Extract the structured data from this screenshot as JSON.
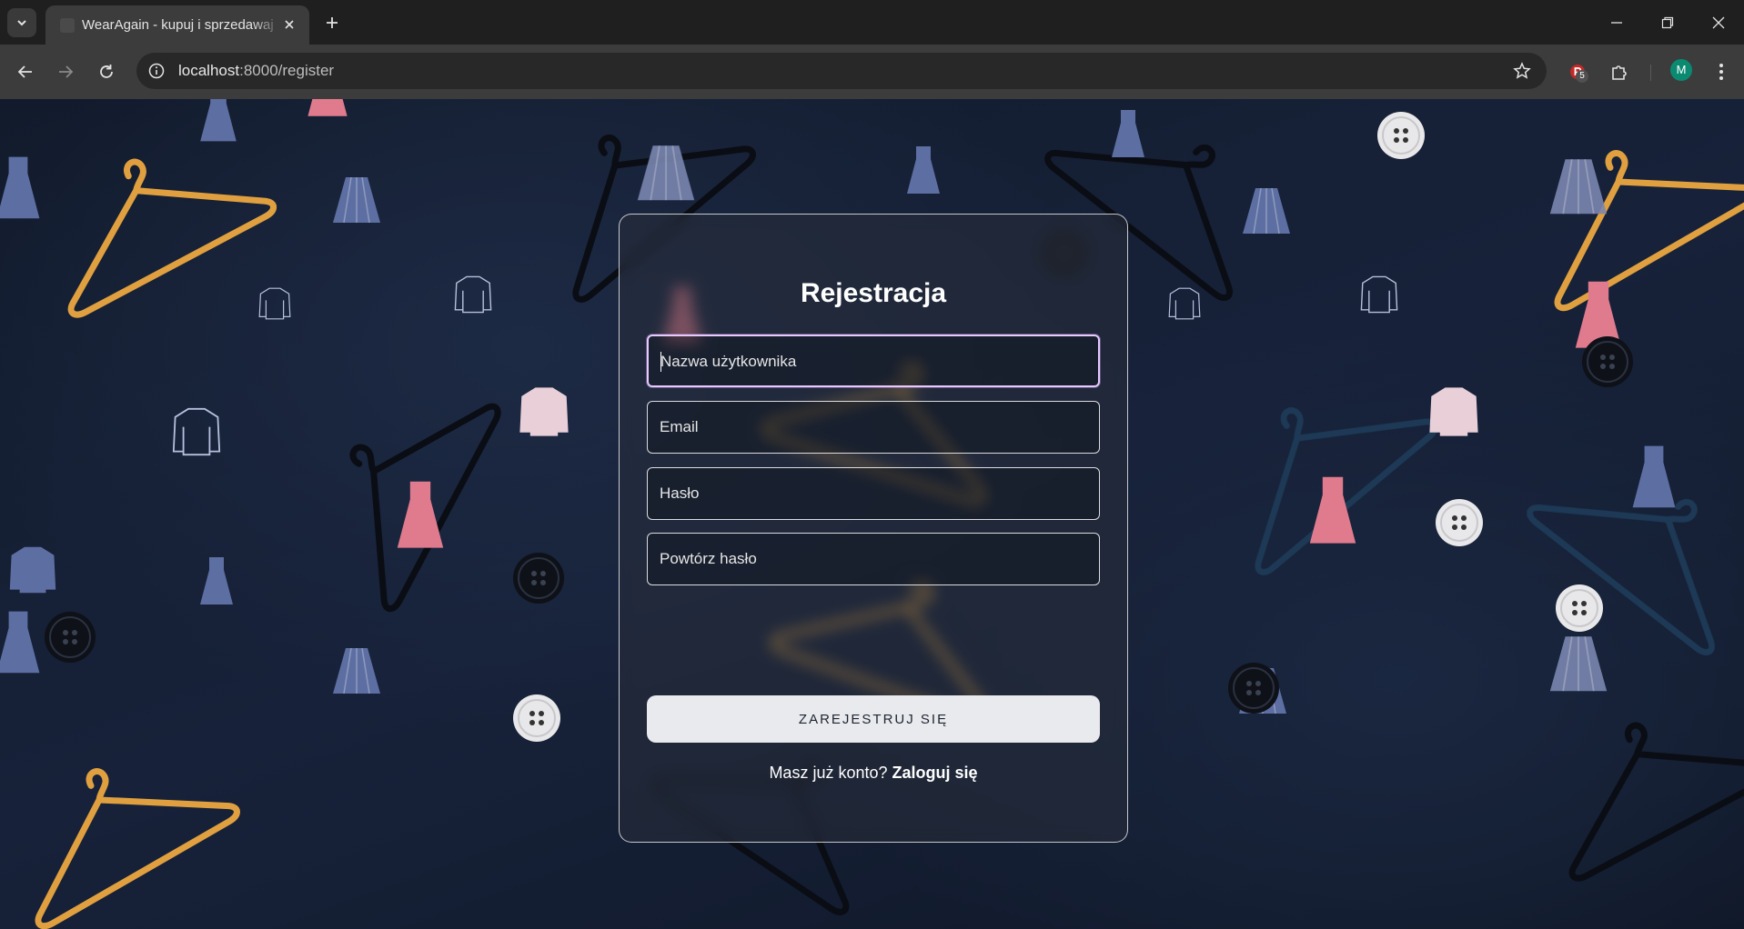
{
  "browser": {
    "tab_title": "WearAgain - kupuj i sprzedawaj",
    "url_host": "localhost",
    "url_rest": ":8000/register",
    "extension_badge": "5",
    "profile_initial": "M"
  },
  "form": {
    "title": "Rejestracja",
    "username_placeholder": "Nazwa użytkownika",
    "email_placeholder": "Email",
    "password_placeholder": "Hasło",
    "password_repeat_placeholder": "Powtórz hasło",
    "submit_label": "ZAREJESTRUJ SIĘ",
    "login_prompt": "Masz już konto?",
    "login_link": "Zaloguj się"
  },
  "colors": {
    "background": "#17223a",
    "focus_ring": "#e8c8ff",
    "button_bg": "#e9eaee"
  }
}
